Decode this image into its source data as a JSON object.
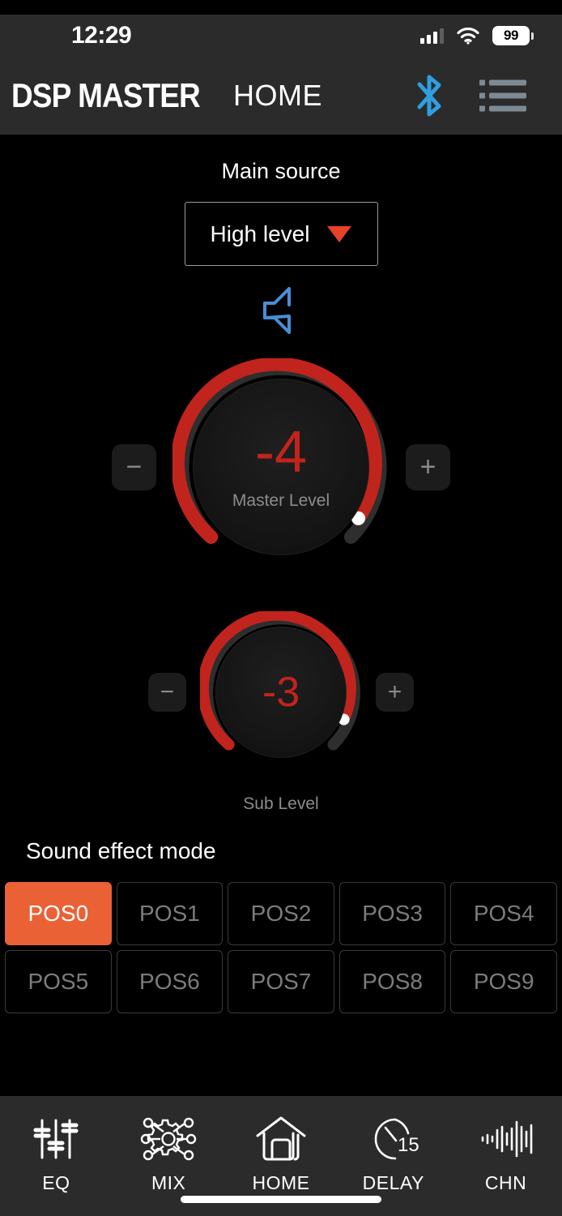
{
  "status_bar": {
    "time": "12:29",
    "signal_icon": "cellular-signal-icon",
    "wifi_icon": "wifi-icon",
    "battery_level": "99",
    "battery_icon": "battery-icon"
  },
  "header": {
    "logo": "DSP MASTER",
    "page_title": "HOME",
    "bluetooth_icon": "bluetooth-icon",
    "menu_icon": "list-menu-icon"
  },
  "main_source": {
    "label": "Main source",
    "selected": "High level",
    "caret_icon": "caret-down-icon",
    "caret_color": "#e8402a",
    "speaker_icon": "speaker-icon",
    "speaker_color": "#4a8fd6"
  },
  "master_knob": {
    "value": "-4",
    "caption": "Master Level",
    "minus_label": "−",
    "plus_label": "+",
    "arc_color": "#c1241c",
    "track_color": "#2e2e2e",
    "thumb_color": "#ffffff",
    "fill_ratio": 0.86
  },
  "sub_knob": {
    "value": "-3",
    "caption": "Sub Level",
    "minus_label": "−",
    "plus_label": "+",
    "arc_color": "#c1241c",
    "track_color": "#2e2e2e",
    "thumb_color": "#ffffff",
    "fill_ratio": 0.78
  },
  "sound_effect_mode": {
    "title": "Sound effect mode",
    "active_color": "#ea6136",
    "presets": [
      {
        "label": "POS0",
        "active": true
      },
      {
        "label": "POS1",
        "active": false
      },
      {
        "label": "POS2",
        "active": false
      },
      {
        "label": "POS3",
        "active": false
      },
      {
        "label": "POS4",
        "active": false
      },
      {
        "label": "POS5",
        "active": false
      },
      {
        "label": "POS6",
        "active": false
      },
      {
        "label": "POS7",
        "active": false
      },
      {
        "label": "POS8",
        "active": false
      },
      {
        "label": "POS9",
        "active": false
      }
    ]
  },
  "bottom_nav": {
    "items": [
      {
        "label": "EQ",
        "icon": "equalizer-sliders-icon"
      },
      {
        "label": "MIX",
        "icon": "mixer-gear-network-icon"
      },
      {
        "label": "HOME",
        "icon": "home-icon"
      },
      {
        "label": "DELAY",
        "icon": "delay-clock-icon",
        "badge": "15"
      },
      {
        "label": "CHN",
        "icon": "waveform-icon"
      }
    ]
  }
}
